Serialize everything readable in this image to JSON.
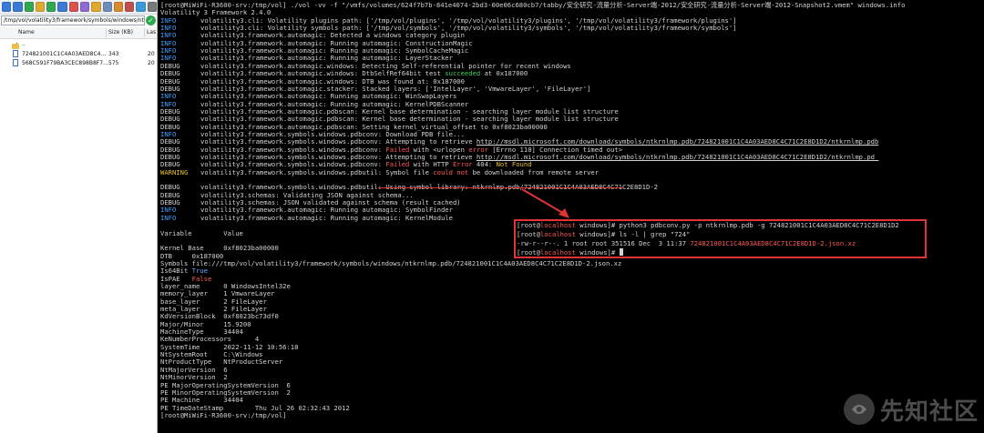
{
  "left_pane": {
    "path": "/tmp/vol/volatility3/framework/symbols/windows/ntkrnlmp",
    "columns": {
      "name": "Name",
      "size": "Size (KB)",
      "last": "Las"
    },
    "rows": [
      {
        "name": "..",
        "size": "",
        "last": ""
      },
      {
        "name": "724821001C1C4A03AED8C4...",
        "size": "343",
        "last": "20"
      },
      {
        "name": "568C591F79BA3CEC898B8F7...",
        "size": "575",
        "last": "20"
      }
    ],
    "toolbar_icons": [
      "back-icon",
      "forward-icon",
      "refresh-icon",
      "home-icon",
      "upload-icon",
      "download-icon",
      "delete-icon",
      "copy-icon",
      "new-folder-icon",
      "properties-icon",
      "edit-icon",
      "bookmark-icon",
      "link-icon",
      "settings-icon"
    ]
  },
  "terminal": {
    "lines": [
      {
        "segs": [
          {
            "t": "[root@MiWiFi-R3600-srv:/tmp/vol] ./vol -vv -f \"/vmfs/volumes/624f7b7b-841e4074-2bd3-00e06c680cb7/tabby/安全研究-流量分析-Server端-2012/安全研究-流量分析-Server端-2012-Snapshot2.vmem\" windows.info"
          }
        ]
      },
      {
        "segs": [
          {
            "t": "Volatility 3 Framework 2.4.0"
          }
        ]
      },
      {
        "lvl": "INFO",
        "segs": [
          {
            "t": "volatility3.cli: Volatility plugins path: ['/tmp/vol/plugins', '/tmp/vol/volatility3/plugins', '/tmp/vol/volatility3/framework/plugins']"
          }
        ]
      },
      {
        "lvl": "INFO",
        "segs": [
          {
            "t": "volatility3.cli: Volatility symbols path: ['/tmp/vol/symbols', '/tmp/vol/volatility3/symbols', '/tmp/vol/volatility3/framework/symbols']"
          }
        ]
      },
      {
        "lvl": "INFO",
        "segs": [
          {
            "t": "volatility3.framework.automagic: Detected a windows category plugin"
          }
        ]
      },
      {
        "lvl": "INFO",
        "segs": [
          {
            "t": "volatility3.framework.automagic: Running automagic: ConstructionMagic"
          }
        ]
      },
      {
        "lvl": "INFO",
        "segs": [
          {
            "t": "volatility3.framework.automagic: Running automagic: SymbolCacheMagic"
          }
        ]
      },
      {
        "lvl": "INFO",
        "segs": [
          {
            "t": "volatility3.framework.automagic: Running automagic: LayerStacker"
          }
        ]
      },
      {
        "lvl": "DEBUG",
        "segs": [
          {
            "t": "volatility3.framework.automagic.windows: Detecting Self-referential pointer for recent windows"
          }
        ]
      },
      {
        "lvl": "DEBUG",
        "segs": [
          {
            "t": "volatility3.framework.automagic.windows: DtbSelfRef64bit test "
          },
          {
            "t": "succeeded",
            "c": "t-green"
          },
          {
            "t": " at 0x187000"
          }
        ]
      },
      {
        "lvl": "DEBUG",
        "segs": [
          {
            "t": "volatility3.framework.automagic.windows: DTB was found at: 0x187000"
          }
        ]
      },
      {
        "lvl": "DEBUG",
        "segs": [
          {
            "t": "volatility3.framework.automagic.stacker: Stacked layers: ['IntelLayer', 'VmwareLayer', 'FileLayer']"
          }
        ]
      },
      {
        "lvl": "INFO",
        "segs": [
          {
            "t": "volatility3.framework.automagic: Running automagic: WinSwapLayers"
          }
        ]
      },
      {
        "lvl": "INFO",
        "segs": [
          {
            "t": "volatility3.framework.automagic: Running automagic: KernelPDBScanner"
          }
        ]
      },
      {
        "lvl": "DEBUG",
        "segs": [
          {
            "t": "volatility3.framework.automagic.pdbscan: Kernel base determination - searching layer module list structure"
          }
        ]
      },
      {
        "lvl": "DEBUG",
        "segs": [
          {
            "t": "volatility3.framework.automagic.pdbscan: Kernel base determination - searching layer module list structure"
          }
        ]
      },
      {
        "lvl": "DEBUG",
        "segs": [
          {
            "t": "volatility3.framework.automagic.pdbscan: Setting kernel_virtual_offset to 0xf8023ba00000"
          }
        ]
      },
      {
        "lvl": "INFO",
        "segs": [
          {
            "t": "volatility3.framework.symbols.windows.pdbconv: Download PDB file..."
          }
        ]
      },
      {
        "lvl": "DEBUG",
        "segs": [
          {
            "t": "volatility3.framework.symbols.windows.pdbconv: Attempting to retrieve "
          },
          {
            "t": "http://msdl.microsoft.com/download/symbols/ntkrnlmp.pdb/724821001C1C4A03AED8C4C71C2E8D1D2/ntkrnlmp.pdb",
            "c": "t-url"
          }
        ]
      },
      {
        "lvl": "DEBUG",
        "segs": [
          {
            "t": "volatility3.framework.symbols.windows.pdbconv: "
          },
          {
            "t": "Failed",
            "c": "t-red"
          },
          {
            "t": " with <urlopen "
          },
          {
            "t": "error",
            "c": "t-red"
          },
          {
            "t": " [Errno 110] Connection timed out>"
          }
        ]
      },
      {
        "lvl": "DEBUG",
        "segs": [
          {
            "t": "volatility3.framework.symbols.windows.pdbconv: Attempting to retrieve "
          },
          {
            "t": "http://msdl.microsoft.com/download/symbols/ntkrnlmp.pdb/724821001C1C4A03AED8C4C71C2E8D1D2/ntkrnlmp.pd_",
            "c": "t-url"
          }
        ]
      },
      {
        "lvl": "DEBUG",
        "segs": [
          {
            "t": "volatility3.framework.symbols.windows.pdbconv: "
          },
          {
            "t": "Failed",
            "c": "t-red"
          },
          {
            "t": " with HTTP "
          },
          {
            "t": "Error",
            "c": "t-red"
          },
          {
            "t": " 404: "
          },
          {
            "t": "Not Found",
            "c": "t-yellow"
          }
        ]
      },
      {
        "lvl": "WARNING",
        "segs": [
          {
            "t": "volatility3.framework.symbols.windows.pdbutil: Symbol file "
          },
          {
            "t": "could not",
            "c": "t-red"
          },
          {
            "t": " be downloaded from remote server"
          }
        ]
      },
      {
        "segs": [
          {
            "t": ""
          }
        ]
      },
      {
        "lvl": "DEBUG",
        "segs": [
          {
            "t": "volatility3.framework.symbols.windows.pdbutil: Using symbol library: ntkrnlmp.pdb/724821001C1C4A03AED8C4C71C2E8D1D-2"
          }
        ]
      },
      {
        "lvl": "DEBUG",
        "segs": [
          {
            "t": "volatility3.schemas: Validating JSON against schema..."
          }
        ]
      },
      {
        "lvl": "DEBUG",
        "segs": [
          {
            "t": "volatility3.schemas: JSON validated against schema (result cached)"
          }
        ]
      },
      {
        "lvl": "INFO",
        "segs": [
          {
            "t": "volatility3.framework.automagic: Running automagic: SymbolFinder"
          }
        ]
      },
      {
        "lvl": "INFO",
        "segs": [
          {
            "t": "volatility3.framework.automagic: Running automagic: KernelModule"
          }
        ]
      },
      {
        "segs": [
          {
            "t": ""
          }
        ]
      },
      {
        "segs": [
          {
            "t": "Variable        Value"
          }
        ]
      },
      {
        "segs": [
          {
            "t": ""
          }
        ]
      },
      {
        "segs": [
          {
            "t": "Kernel Base     0xf8023ba00000"
          }
        ]
      },
      {
        "segs": [
          {
            "t": "DTB     0x187000"
          }
        ]
      },
      {
        "segs": [
          {
            "t": "Symbols file:///tmp/vol/volatility3/framework/symbols/windows/ntkrnlmp.pdb/724821001C1C4A03AED8C4C71C2E8D1D-2.json.xz"
          }
        ]
      },
      {
        "segs": [
          {
            "t": "Is64Bit "
          },
          {
            "t": "True",
            "c": "t-blue"
          }
        ]
      },
      {
        "segs": [
          {
            "t": "IsPAE   "
          },
          {
            "t": "False",
            "c": "t-red"
          }
        ]
      },
      {
        "segs": [
          {
            "t": "layer_name      0 WindowsIntel32e"
          }
        ]
      },
      {
        "segs": [
          {
            "t": "memory_layer    1 VmwareLayer"
          }
        ]
      },
      {
        "segs": [
          {
            "t": "base_layer      2 FileLayer"
          }
        ]
      },
      {
        "segs": [
          {
            "t": "meta_layer      2 FileLayer"
          }
        ]
      },
      {
        "segs": [
          {
            "t": "KdVersionBlock  0xf8023bc73df0"
          }
        ]
      },
      {
        "segs": [
          {
            "t": "Major/Minor     15.9200"
          }
        ]
      },
      {
        "segs": [
          {
            "t": "MachineType     34404"
          }
        ]
      },
      {
        "segs": [
          {
            "t": "KeNumberProcessors      4"
          }
        ]
      },
      {
        "segs": [
          {
            "t": "SystemTime      2022-11-12 10:56:18"
          }
        ]
      },
      {
        "segs": [
          {
            "t": "NtSystemRoot    C:\\Windows"
          }
        ]
      },
      {
        "segs": [
          {
            "t": "NtProductType   NtProductServer"
          }
        ]
      },
      {
        "segs": [
          {
            "t": "NtMajorVersion  6"
          }
        ]
      },
      {
        "segs": [
          {
            "t": "NtMinorVersion  2"
          }
        ]
      },
      {
        "segs": [
          {
            "t": "PE MajorOperatingSystemVersion  6"
          }
        ]
      },
      {
        "segs": [
          {
            "t": "PE MinorOperatingSystemVersion  2"
          }
        ]
      },
      {
        "segs": [
          {
            "t": "PE Machine      34404"
          }
        ]
      },
      {
        "segs": [
          {
            "t": "PE TimeDateStamp        Thu Jul 26 02:32:43 2012"
          }
        ]
      },
      {
        "segs": [
          {
            "t": "[root@MiWiFi-R3600-srv:/tmp/vol] "
          }
        ]
      }
    ],
    "callout_lines": [
      {
        "segs": [
          {
            "t": "[root@"
          },
          {
            "t": "localhost",
            "c": "t-red"
          },
          {
            "t": " windows]# python3 pdbconv.py -p ntkrnlmp.pdb -g 724821001C1C4A03AED8C4C71C2E8D1D2"
          }
        ]
      },
      {
        "segs": [
          {
            "t": "[root@"
          },
          {
            "t": "localhost",
            "c": "t-red"
          },
          {
            "t": " windows]# ls -l | grep \"724\""
          }
        ]
      },
      {
        "segs": [
          {
            "t": "-rw-r--r--. 1 root root 351516 Dec  3 11:37 "
          },
          {
            "t": "724821001C1C4A03AED8C4C71C2E8D1D-2.json.xz",
            "c": "t-red"
          }
        ]
      },
      {
        "segs": [
          {
            "t": "[root@"
          },
          {
            "t": "localhost",
            "c": "t-red"
          },
          {
            "t": " windows]# "
          }
        ],
        "cursor": true
      }
    ]
  },
  "watermark": {
    "text": "先知社区",
    "icon": "xianzhi-logo-icon"
  },
  "colors": {
    "info": "#4a9eff",
    "warning": "#e6c229",
    "error": "#ff5a5a",
    "ok": "#3fd25a",
    "callout_border": "#e03333"
  }
}
